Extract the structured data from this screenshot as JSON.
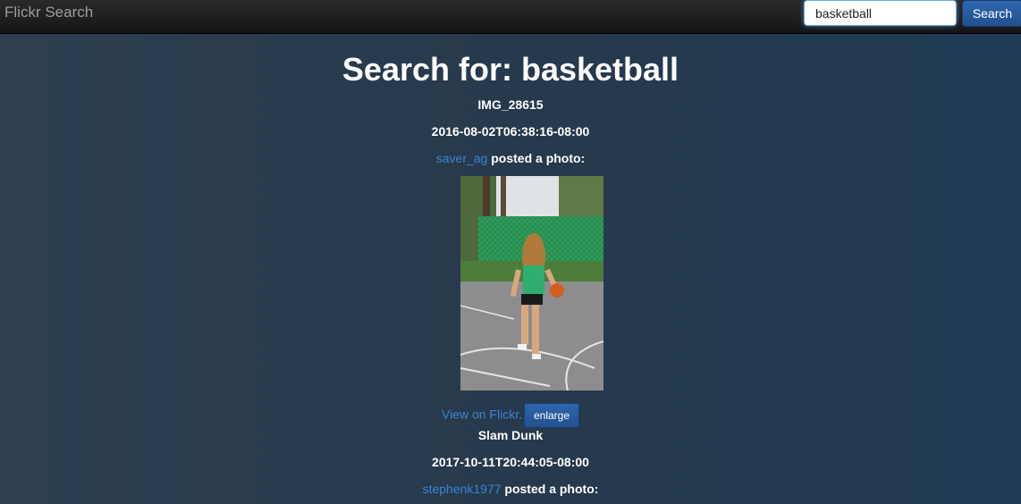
{
  "navbar": {
    "brand": "Flickr Search",
    "search_value": "basketball",
    "search_button": "Search"
  },
  "page_title": "Search for: basketball",
  "results": [
    {
      "title": "IMG_28615",
      "date": "2016-08-02T06:38:16-08:00",
      "author": "saver_ag",
      "posted_text": " posted a photo:",
      "view_link": "View on Flickr.",
      "enlarge": "enlarge"
    },
    {
      "title": "Slam Dunk",
      "date": "2017-10-11T20:44:05-08:00",
      "author": "stephenk1977",
      "posted_text": " posted a photo:"
    }
  ],
  "colors": {
    "link": "#3d82d6",
    "button": "#2a5c9e"
  }
}
